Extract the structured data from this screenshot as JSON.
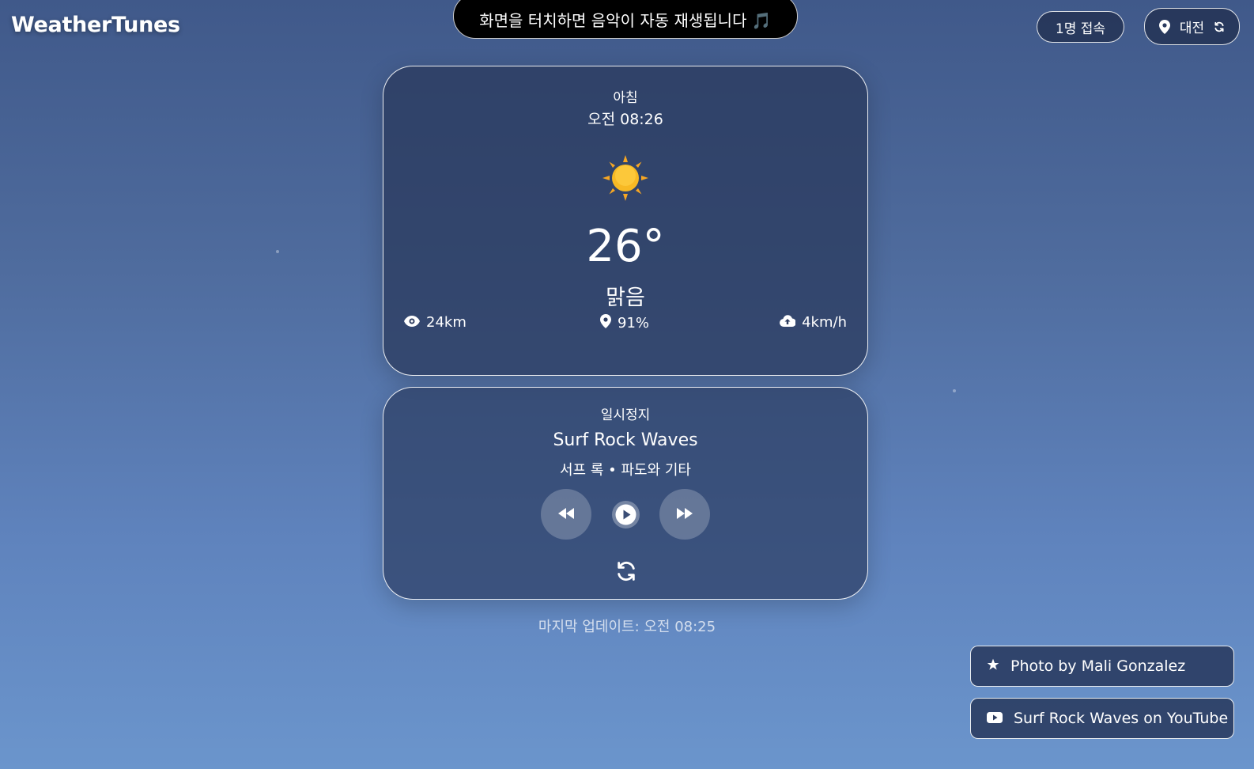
{
  "app": {
    "title": "WeatherTunes"
  },
  "banner": {
    "text": "화면을 터치하면 음악이 자동 재생됩니다 🎵"
  },
  "header": {
    "users": "1명 접속",
    "location": "대전"
  },
  "weather": {
    "period": "아침",
    "time": "오전 08:26",
    "icon": "sun-icon",
    "temperature": "26°",
    "condition": "맑음",
    "visibility": "24km",
    "humidity": "91%",
    "wind": "4km/h"
  },
  "player": {
    "status": "일시정지",
    "track": "Surf Rock Waves",
    "genre": "서프 록 • 파도와 기타",
    "state": "paused"
  },
  "footer": {
    "updated": "마지막 업데이트: 오전 08:25"
  },
  "credits": {
    "photo": "Photo by Mali Gonzalez",
    "youtube": "Surf Rock Waves on YouTube"
  },
  "colors": {
    "accent_sun": "#f6b81f",
    "card_bg": "#2c3b5e",
    "banner_bg": "#000000"
  }
}
